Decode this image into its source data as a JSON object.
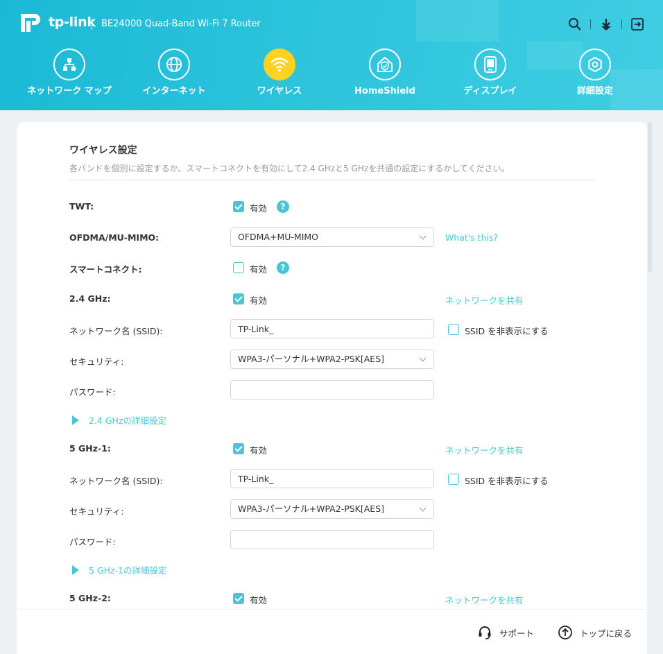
{
  "header": {
    "logo_text": "tp-link",
    "model": "BE24000 Quad-Band Wi-Fi 7 Router",
    "icons": [
      "search-icon",
      "download-icon",
      "logout-icon"
    ]
  },
  "nav": [
    {
      "label": "ネットワーク マップ",
      "icon": "network-map-icon"
    },
    {
      "label": "インターネット",
      "icon": "globe-icon"
    },
    {
      "label": "ワイヤレス",
      "icon": "wifi-icon",
      "active": true
    },
    {
      "label": "HomeShield",
      "icon": "homeshield-icon"
    },
    {
      "label": "ディスプレイ",
      "icon": "display-icon"
    },
    {
      "label": "詳細設定",
      "icon": "gear-icon"
    }
  ],
  "section": {
    "title": "ワイヤレス設定",
    "description": "各バンドを個別に設定するか、スマートコネクトを有効にして2.4 GHzと5 GHzを共通の設定にするかしてください。"
  },
  "twt": {
    "label": "TWT:",
    "checkbox_label": "有効",
    "checked": true
  },
  "ofdma": {
    "label": "OFDMA/MU-MIMO:",
    "value": "OFDMA+MU-MIMO",
    "link": "What's this?"
  },
  "smart_connect": {
    "label": "スマートコネクト:",
    "checkbox_label": "有効",
    "checked": false
  },
  "band_24": {
    "label": "2.4 GHz:",
    "checkbox_label": "有効",
    "share_link": "ネットワークを共有",
    "ssid_label": "ネットワーク名 (SSID):",
    "ssid_value": "TP-Link_",
    "hide_ssid_label": "SSID を非表示にする",
    "security_label": "セキュリティ:",
    "security_value": "WPA3-パーソナル+WPA2-PSK[AES]",
    "password_label": "パスワード:",
    "password_value": "",
    "advanced": "2.4 GHzの詳細設定"
  },
  "band_5_1": {
    "label": "5 GHz-1:",
    "checkbox_label": "有効",
    "share_link": "ネットワークを共有",
    "ssid_label": "ネットワーク名 (SSID):",
    "ssid_value": "TP-Link_",
    "hide_ssid_label": "SSID を非表示にする",
    "security_label": "セキュリティ:",
    "security_value": "WPA3-パーソナル+WPA2-PSK[AES]",
    "password_label": "パスワード:",
    "password_value": "",
    "advanced": "5 GHz-1の詳細設定"
  },
  "band_5_2": {
    "label": "5 GHz-2:",
    "checkbox_label": "有効",
    "share_link": "ネットワークを共有"
  },
  "footer": {
    "support": "サポート",
    "back_to_top": "トップに戻る"
  },
  "colors": {
    "accent": "#4bc5d6",
    "header": "#2cc3dc",
    "active_nav": "#ffd21f"
  }
}
